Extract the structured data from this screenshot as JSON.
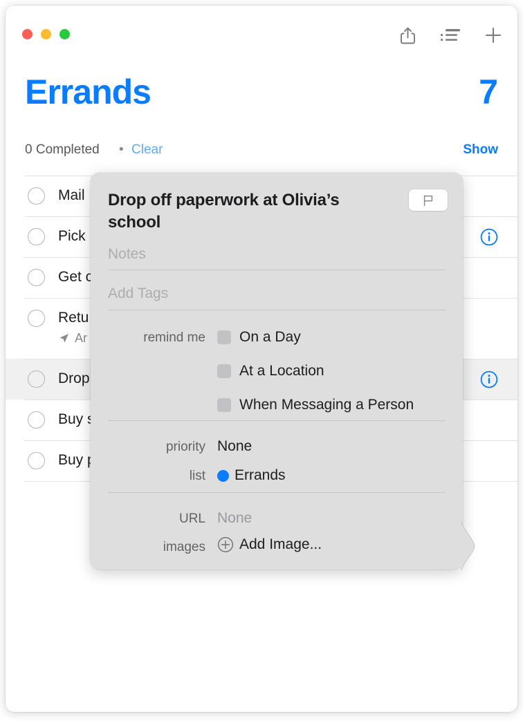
{
  "window": {
    "traffic_lights": [
      {
        "name": "close-button",
        "color": "#ff5f57"
      },
      {
        "name": "minimize-button",
        "color": "#febc2e"
      },
      {
        "name": "zoom-button",
        "color": "#28c840"
      }
    ],
    "toolbar": [
      {
        "name": "share-icon",
        "label": "Share"
      },
      {
        "name": "list-view-icon",
        "label": "View Options"
      },
      {
        "name": "add-icon",
        "label": "Add Reminder"
      }
    ]
  },
  "header": {
    "title": "Errands",
    "count": "7",
    "accent_color": "#0a7cff",
    "completed_text": "0 Completed",
    "separator": "•",
    "clear_label": "Clear",
    "show_label": "Show"
  },
  "reminders": [
    {
      "title": "Mail",
      "subtitle": "",
      "selected": false,
      "has_info": false
    },
    {
      "title": "Pick",
      "subtitle": "",
      "selected": false,
      "has_info": true
    },
    {
      "title": "Get c",
      "subtitle": "",
      "selected": false,
      "has_info": false
    },
    {
      "title": "Retu",
      "subtitle": "Ar",
      "selected": false,
      "has_info": false
    },
    {
      "title": "Drop",
      "subtitle": "",
      "selected": true,
      "has_info": true
    },
    {
      "title": "Buy s",
      "subtitle": "",
      "selected": false,
      "has_info": false
    },
    {
      "title": "Buy p",
      "subtitle": "",
      "selected": false,
      "has_info": false
    }
  ],
  "popover": {
    "title": "Drop off paperwork at Olivia’s school",
    "flag_button": "flag-icon",
    "notes_placeholder": "Notes",
    "tags_placeholder": "Add Tags",
    "remind_me_label": "remind me",
    "remind_options": [
      {
        "label": "On a Day",
        "checked": false
      },
      {
        "label": "At a Location",
        "checked": false
      },
      {
        "label": "When Messaging a Person",
        "checked": false
      }
    ],
    "priority_label": "priority",
    "priority_value": "None",
    "list_label": "list",
    "list_value": "Errands",
    "list_color": "#0a7cff",
    "url_label": "URL",
    "url_value": "None",
    "images_label": "images",
    "add_image_label": "Add Image..."
  }
}
